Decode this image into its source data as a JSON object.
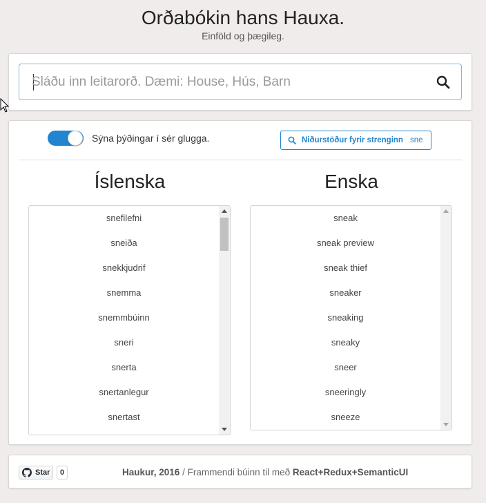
{
  "header": {
    "title": "Orðabókin hans Hauxa.",
    "subtitle": "Einföld og þægileg."
  },
  "search": {
    "placeholder": "Sláðu inn leitarorð. Dæmi: House, Hús, Barn",
    "value": "",
    "icon": "search-icon"
  },
  "options": {
    "toggle_label": "Sýna þýðingar í sér glugga.",
    "toggle_on": true,
    "results_label": "Niðurstöður fyrir strenginn",
    "results_term": "sne"
  },
  "columns": {
    "icelandic": {
      "heading": "Íslenska",
      "items": [
        "snefilefni",
        "sneiða",
        "snekkjudrif",
        "snemma",
        "snemmbúinn",
        "sneri",
        "snerta",
        "snertanlegur",
        "snertast"
      ]
    },
    "english": {
      "heading": "Enska",
      "items": [
        "sneak",
        "sneak preview",
        "sneak thief",
        "sneaker",
        "sneaking",
        "sneaky",
        "sneer",
        "sneeringly",
        "sneeze"
      ]
    }
  },
  "footer": {
    "star_label": "Star",
    "star_count": "0",
    "author": "Haukur, 2016",
    "separator": " / ",
    "text": "Frammendi búinn til með ",
    "stack": "React+Redux+SemanticUI"
  },
  "colors": {
    "accent": "#2185d0",
    "background": "#efeceb",
    "search_border": "#85b7d9"
  }
}
